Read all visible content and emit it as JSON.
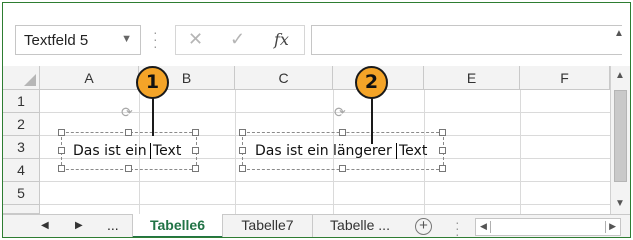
{
  "name_box": {
    "value": "Textfeld 5"
  },
  "formula_bar": {
    "cancel_glyph": "✕",
    "enter_glyph": "✓",
    "fx_label": "fx",
    "value": ""
  },
  "columns": [
    "A",
    "B",
    "C",
    "D",
    "E",
    "F"
  ],
  "rows": [
    "1",
    "2",
    "3",
    "4",
    "5"
  ],
  "textboxes": [
    {
      "text": "Das ist ein",
      "text_after": "Text"
    },
    {
      "text": "Das ist ein längerer",
      "text_after": "Text"
    }
  ],
  "callouts": [
    "1",
    "2"
  ],
  "sheet_tabs": {
    "overflow_label": "...",
    "tabs": [
      {
        "label": "Tabelle6",
        "active": true
      },
      {
        "label": "Tabelle7",
        "active": false
      },
      {
        "label": "Tabelle ...",
        "active": false
      }
    ],
    "add_label": "+"
  },
  "colors": {
    "accent_green": "#217346",
    "callout_fill": "#f4a428"
  }
}
